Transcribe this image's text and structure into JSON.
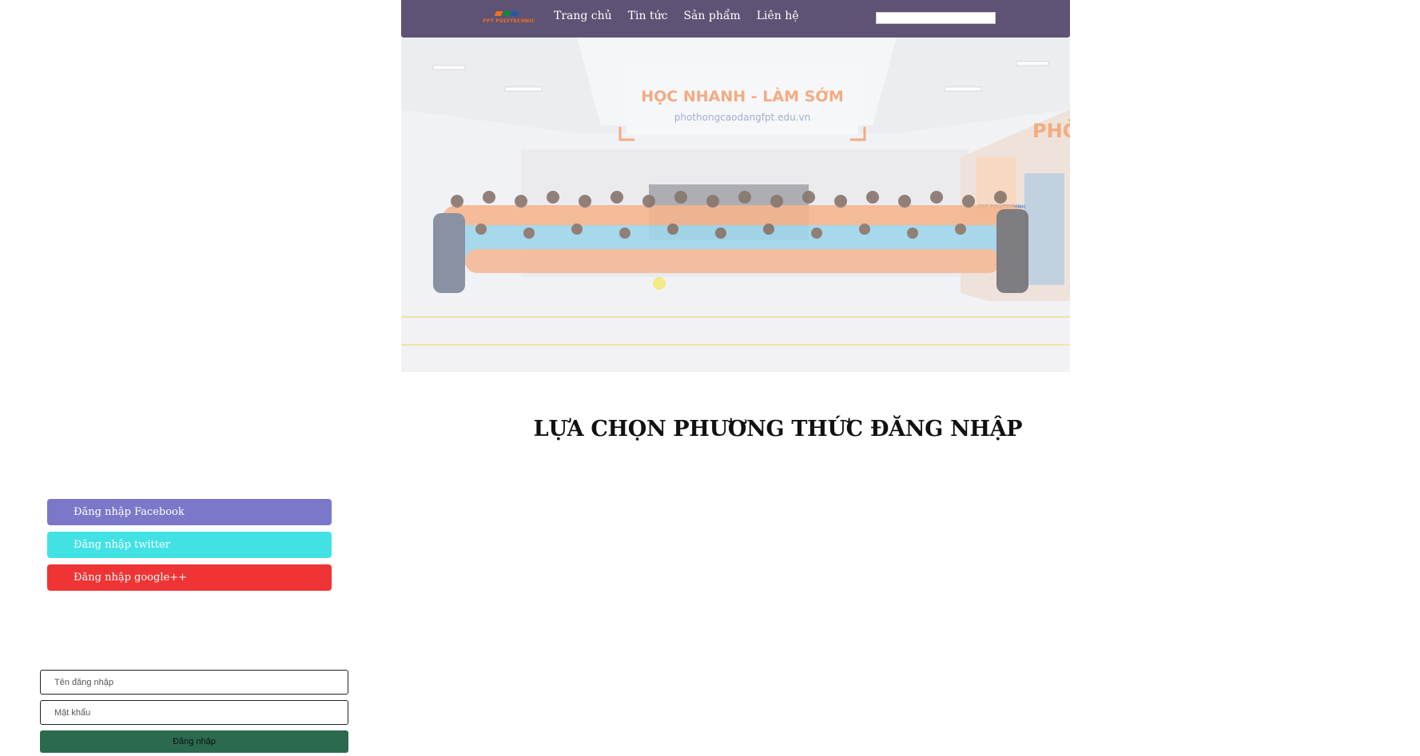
{
  "header": {
    "logo_text": "FPT POLYTECHNIC",
    "logo_colors": [
      "#f36f21",
      "#0a8a3c",
      "#1f5aa6"
    ],
    "nav": [
      {
        "label": "Trang chủ"
      },
      {
        "label": "Tin tức"
      },
      {
        "label": "Sản phẩm"
      },
      {
        "label": "Liên hệ"
      }
    ],
    "search": {
      "value": "",
      "placeholder": ""
    },
    "background_color": "#5e5375"
  },
  "banner": {
    "sign_text": "HỌC NHANH - LÀM SỚM",
    "sign_subtext": "phothongcaodangfpt.edu.vn",
    "wall_text": "PHÒN",
    "wall_logo_text": "FPT POLYTECHNIC"
  },
  "main": {
    "title": "LỰA CHỌN PHƯƠNG THỨC ĐĂNG NHẬP"
  },
  "social_login": [
    {
      "label": "Đăng nhập Facebook",
      "color": "#7b78c9"
    },
    {
      "label": "Đăng nhập twitter",
      "color": "#42e2e4"
    },
    {
      "label": "Đăng nhập google++",
      "color": "#ee3434"
    }
  ],
  "login_form": {
    "username_placeholder": "Tên đăng nhập",
    "password_placeholder": "Mật khẩu",
    "submit_label": "Đăng nhập",
    "submit_color": "#2c6a50"
  }
}
